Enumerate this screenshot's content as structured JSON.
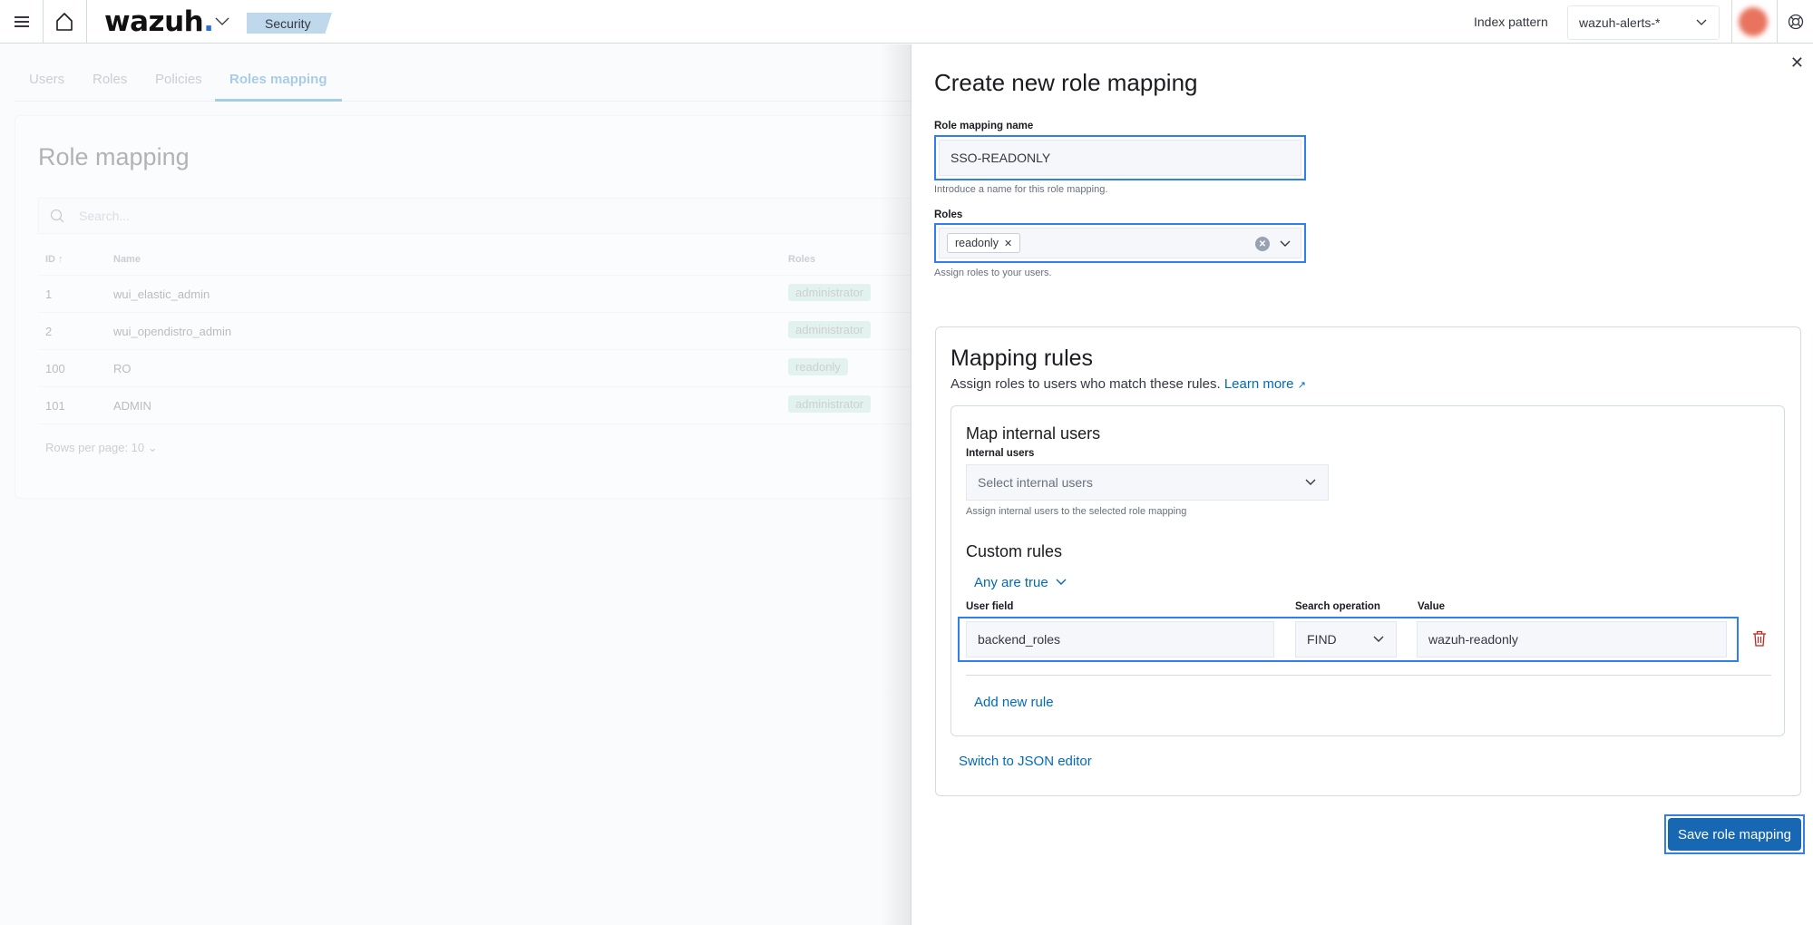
{
  "header": {
    "logo_text": "wazuh",
    "logo_dot": ".",
    "breadcrumb": "Security",
    "index_pattern_label": "Index pattern",
    "index_pattern_value": "wazuh-alerts-*"
  },
  "background": {
    "tabs": [
      "Users",
      "Roles",
      "Policies",
      "Roles mapping"
    ],
    "active_tab": "Roles mapping",
    "title": "Role mapping",
    "search_placeholder": "Search...",
    "columns": [
      "ID",
      "Name",
      "Roles"
    ],
    "rows": [
      {
        "id": "1",
        "name": "wui_elastic_admin",
        "role": "administrator"
      },
      {
        "id": "2",
        "name": "wui_opendistro_admin",
        "role": "administrator"
      },
      {
        "id": "100",
        "name": "RO",
        "role": "readonly"
      },
      {
        "id": "101",
        "name": "ADMIN",
        "role": "administrator"
      }
    ],
    "rows_per_page": "Rows per page: 10"
  },
  "flyout": {
    "title": "Create new role mapping",
    "name_label": "Role mapping name",
    "name_value": "SSO-READONLY",
    "name_help": "Introduce a name for this role mapping.",
    "roles_label": "Roles",
    "roles_selected": [
      "readonly"
    ],
    "roles_help": "Assign roles to your users.",
    "mapping": {
      "title": "Mapping rules",
      "subtitle": "Assign roles to users who match these rules.",
      "learn_more": "Learn more",
      "internal": {
        "title": "Map internal users",
        "label": "Internal users",
        "placeholder": "Select internal users",
        "help": "Assign internal users to the selected role mapping"
      },
      "custom": {
        "title": "Custom rules",
        "operator": "Any are true",
        "user_field_label": "User field",
        "search_op_label": "Search operation",
        "value_label": "Value",
        "rule": {
          "user_field": "backend_roles",
          "search_op": "FIND",
          "value": "wazuh-readonly"
        },
        "add_rule": "Add new rule"
      },
      "json_editor": "Switch to JSON editor"
    },
    "save_label": "Save role mapping"
  }
}
